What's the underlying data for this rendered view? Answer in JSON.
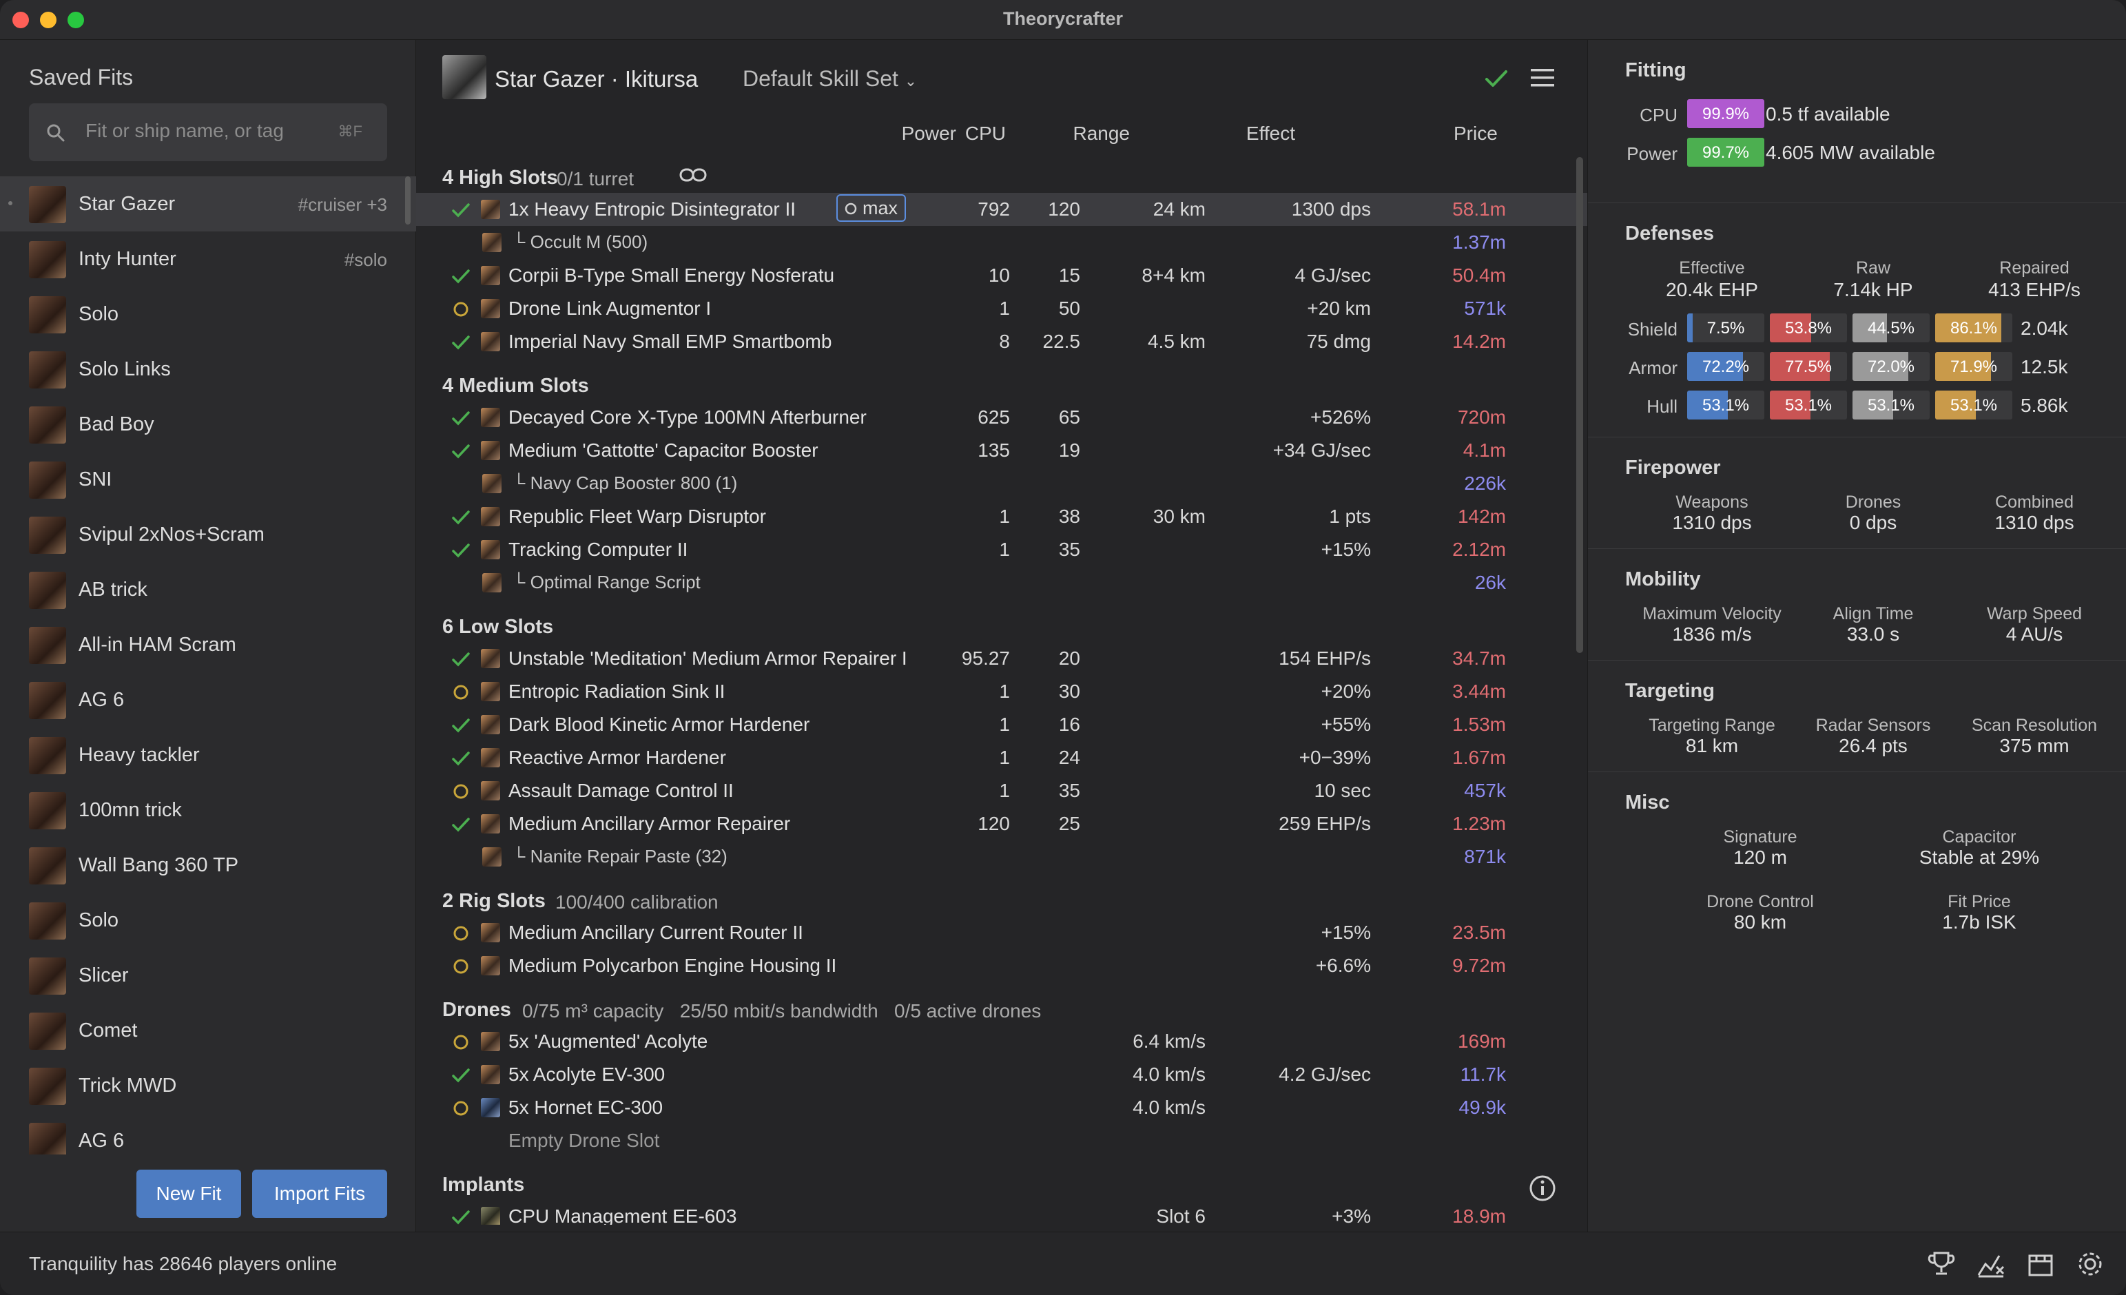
{
  "app_title": "Theorycrafter",
  "sidebar": {
    "title": "Saved Fits",
    "search_placeholder": "Fit or ship name, or tag",
    "search_shortcut": "⌘F",
    "fits": [
      {
        "name": "Star Gazer",
        "tag": "#cruiser +3"
      },
      {
        "name": "Inty Hunter",
        "tag": "#solo"
      },
      {
        "name": "Solo",
        "tag": ""
      },
      {
        "name": "Solo Links",
        "tag": ""
      },
      {
        "name": "Bad Boy",
        "tag": ""
      },
      {
        "name": "SNI",
        "tag": ""
      },
      {
        "name": "Svipul 2xNos+Scram",
        "tag": ""
      },
      {
        "name": "AB trick",
        "tag": ""
      },
      {
        "name": "All-in HAM Scram",
        "tag": ""
      },
      {
        "name": "AG 6",
        "tag": ""
      },
      {
        "name": "Heavy tackler",
        "tag": ""
      },
      {
        "name": "100mn trick",
        "tag": ""
      },
      {
        "name": "Wall Bang 360 TP",
        "tag": ""
      },
      {
        "name": "Solo",
        "tag": ""
      },
      {
        "name": "Slicer",
        "tag": ""
      },
      {
        "name": "Comet",
        "tag": ""
      },
      {
        "name": "Trick MWD",
        "tag": ""
      },
      {
        "name": "AG 6",
        "tag": ""
      }
    ],
    "new_fit_label": "New Fit",
    "import_fits_label": "Import Fits"
  },
  "footer": {
    "status": "Tranquility has 28646 players online"
  },
  "main": {
    "ship_title": "Star Gazer · Ikitursa",
    "skill_set": "Default Skill Set",
    "columns": {
      "power": "Power",
      "cpu": "CPU",
      "range": "Range",
      "effect": "Effect",
      "price": "Price"
    },
    "sections": {
      "high": {
        "title": "4 High Slots",
        "sub": "0/1 turret"
      },
      "medium": {
        "title": "4 Medium Slots",
        "sub": ""
      },
      "low": {
        "title": "6 Low Slots",
        "sub": ""
      },
      "rig": {
        "title": "2 Rig Slots",
        "sub": "100/400 calibration"
      },
      "drones": {
        "title": "Drones",
        "sub": "0/75 m³ capacity   25/50 mbit/s bandwidth   0/5 active drones"
      },
      "implants": {
        "title": "Implants",
        "sub": ""
      }
    },
    "rows": {
      "h1": {
        "name": "1x Heavy Entropic Disintegrator II",
        "tag": "max",
        "power": "792",
        "cpu": "120",
        "range": "24 km",
        "effect": "1300 dps",
        "price": "58.1m"
      },
      "h1a": {
        "name": "└ Occult M (500)",
        "price": "1.37m"
      },
      "h2": {
        "name": "Corpii B-Type Small Energy Nosferatu",
        "power": "10",
        "cpu": "15",
        "range": "8+4 km",
        "effect": "4 GJ/sec",
        "price": "50.4m"
      },
      "h3": {
        "name": "Drone Link Augmentor I",
        "power": "1",
        "cpu": "50",
        "effect": "+20 km",
        "price": "571k"
      },
      "h4": {
        "name": "Imperial Navy Small EMP Smartbomb",
        "power": "8",
        "cpu": "22.5",
        "range": "4.5 km",
        "effect": "75 dmg",
        "price": "14.2m"
      },
      "m1": {
        "name": "Decayed Core X-Type 100MN Afterburner",
        "power": "625",
        "cpu": "65",
        "effect": "+526%",
        "price": "720m"
      },
      "m2": {
        "name": "Medium 'Gattotte' Capacitor Booster",
        "power": "135",
        "cpu": "19",
        "effect": "+34 GJ/sec",
        "price": "4.1m"
      },
      "m2a": {
        "name": "└ Navy Cap Booster 800 (1)",
        "price": "226k"
      },
      "m3": {
        "name": "Republic Fleet Warp Disruptor",
        "power": "1",
        "cpu": "38",
        "range": "30 km",
        "effect": "1 pts",
        "price": "142m"
      },
      "m4": {
        "name": "Tracking Computer II",
        "power": "1",
        "cpu": "35",
        "effect": "+15%",
        "price": "2.12m"
      },
      "m4a": {
        "name": "└ Optimal Range Script",
        "price": "26k"
      },
      "l1": {
        "name": "Unstable 'Meditation' Medium Armor Repairer I",
        "power": "95.27",
        "cpu": "20",
        "effect": "154 EHP/s",
        "price": "34.7m"
      },
      "l2": {
        "name": "Entropic Radiation Sink II",
        "power": "1",
        "cpu": "30",
        "effect": "+20%",
        "price": "3.44m"
      },
      "l3": {
        "name": "Dark Blood Kinetic Armor Hardener",
        "power": "1",
        "cpu": "16",
        "effect": "+55%",
        "price": "1.53m"
      },
      "l4": {
        "name": "Reactive Armor Hardener",
        "power": "1",
        "cpu": "24",
        "effect": "+0−39%",
        "price": "1.67m"
      },
      "l5": {
        "name": "Assault Damage Control II",
        "power": "1",
        "cpu": "35",
        "effect": "10 sec",
        "price": "457k"
      },
      "l6": {
        "name": "Medium Ancillary Armor Repairer",
        "power": "120",
        "cpu": "25",
        "effect": "259 EHP/s",
        "price": "1.23m"
      },
      "l6a": {
        "name": "└ Nanite Repair Paste (32)",
        "price": "871k"
      },
      "r1": {
        "name": "Medium Ancillary Current Router II",
        "effect": "+15%",
        "price": "23.5m"
      },
      "r2": {
        "name": "Medium Polycarbon Engine Housing II",
        "effect": "+6.6%",
        "price": "9.72m"
      },
      "d1": {
        "name": "5x 'Augmented' Acolyte",
        "range": "6.4 km/s",
        "price": "169m"
      },
      "d2": {
        "name": "5x Acolyte EV-300",
        "range": "4.0 km/s",
        "effect": "4.2 GJ/sec",
        "price": "11.7k"
      },
      "d3": {
        "name": "5x Hornet EC-300",
        "range": "4.0 km/s",
        "price": "49.9k"
      },
      "d4": {
        "name": "Empty Drone Slot"
      },
      "i1": {
        "name": "CPU Management EE-603",
        "range": "Slot 6",
        "effect": "+3%",
        "price": "18.9m"
      }
    }
  },
  "panel": {
    "fitting": {
      "title": "Fitting",
      "cpu_label": "CPU",
      "cpu_pct": "99.9%",
      "cpu_text": "0.5 tf available",
      "cpu_fill": 0.999,
      "power_label": "Power",
      "power_pct": "99.7%",
      "power_text": "4.605 MW available",
      "power_fill": 0.997
    },
    "defenses": {
      "title": "Defenses",
      "effective_label": "Effective",
      "effective_value": "20.4k EHP",
      "raw_label": "Raw",
      "raw_value": "7.14k HP",
      "repaired_label": "Repaired",
      "repaired_value": "413 EHP/s",
      "rows": [
        {
          "label": "Shield",
          "values": [
            "7.5%",
            "53.8%",
            "44.5%",
            "86.1%"
          ],
          "fills": [
            0.075,
            0.538,
            0.445,
            0.861
          ],
          "hp": "2.04k"
        },
        {
          "label": "Armor",
          "values": [
            "72.2%",
            "77.5%",
            "72.0%",
            "71.9%"
          ],
          "fills": [
            0.722,
            0.775,
            0.72,
            0.719
          ],
          "hp": "12.5k"
        },
        {
          "label": "Hull",
          "values": [
            "53.1%",
            "53.1%",
            "53.1%",
            "53.1%"
          ],
          "fills": [
            0.531,
            0.531,
            0.531,
            0.531
          ],
          "hp": "5.86k"
        }
      ]
    },
    "firepower": {
      "title": "Firepower",
      "weapons_label": "Weapons",
      "weapons_value": "1310 dps",
      "drones_label": "Drones",
      "drones_value": "0 dps",
      "combined_label": "Combined",
      "combined_value": "1310 dps"
    },
    "mobility": {
      "title": "Mobility",
      "velocity_label": "Maximum Velocity",
      "velocity_value": "1836 m/s",
      "align_label": "Align Time",
      "align_value": "33.0 s",
      "warp_label": "Warp Speed",
      "warp_value": "4 AU/s"
    },
    "targeting": {
      "title": "Targeting",
      "range_label": "Targeting Range",
      "range_value": "81 km",
      "sensors_label": "Radar Sensors",
      "sensors_value": "26.4 pts",
      "scanres_label": "Scan Resolution",
      "scanres_value": "375 mm"
    },
    "misc": {
      "title": "Misc",
      "signature_label": "Signature",
      "signature_value": "120 m",
      "capacitor_label": "Capacitor",
      "capacitor_value": "Stable at 29%",
      "drone_control_label": "Drone Control",
      "drone_control_value": "80 km",
      "fit_price_label": "Fit Price",
      "fit_price_value": "1.7b ISK"
    }
  },
  "colors": {
    "accent": "#4d7cc2",
    "check": "#4caf50",
    "partial": "#c9a63a",
    "price_red": "#e06d72",
    "price_blue": "#8e8cf0",
    "cpu_bar": "#b05ad0",
    "power_bar": "#4caf50",
    "em": "#4d7cc2",
    "thermal": "#c95454",
    "kinetic": "#9a9a9a",
    "explosive": "#c99a4a"
  }
}
